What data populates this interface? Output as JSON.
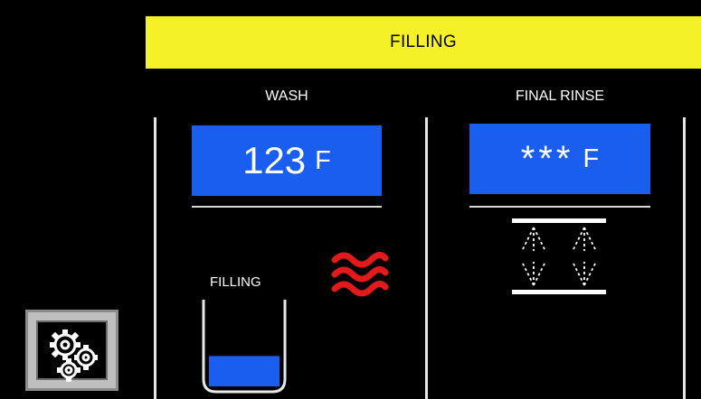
{
  "status": {
    "label": "FILLING",
    "color": "#f4f128"
  },
  "wash": {
    "title": "WASH",
    "temperature": "123",
    "unit": "F",
    "tank_label": "FILLING",
    "fill_level": 0.35,
    "heater_icon": "heat-waves-icon"
  },
  "final_rinse": {
    "title": "FINAL RINSE",
    "temperature": "***",
    "unit": "F",
    "spray_icon": "spray-arms-icon"
  },
  "settings": {
    "icon": "gears-icon"
  },
  "colors": {
    "temp_box": "#1a5ef0",
    "water": "#1a5ef0",
    "heat": "#e21a1a"
  }
}
